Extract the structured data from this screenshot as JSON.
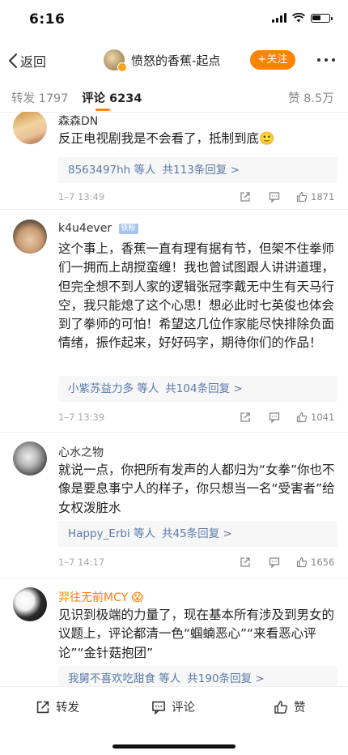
{
  "status_bar": {
    "time": "6:16",
    "battery_level": 0.5
  },
  "nav": {
    "back_label": "返回",
    "title": "愤怒的香蕉-起点",
    "follow_label": "+关注"
  },
  "tabs": [
    {
      "label": "转发 1797"
    },
    {
      "label": "评论 6234"
    },
    {
      "label": "赞 8.5万"
    }
  ],
  "comments": [
    {
      "name": "森森DN",
      "text": "反正电视剧我是不会看了，抵制到底🙂",
      "reply_users": "8563497hh 等人",
      "reply_count": "共113条回复 >",
      "time": "1–7 13:49",
      "likes": "1871"
    },
    {
      "name": "k4u4ever",
      "badge": "铁粉",
      "text": "这个事上，香蕉一直有理有据有节，但架不住拳师们一拥而上胡搅蛮缠！我也曾试图跟人讲讲道理，但完全想不到人家的逻辑张冠李戴无中生有天马行空，我只能熄了这个心思！想必此时七英俊也体会到了拳师的可怕！希望这几位作家能尽快排除负面情绪，振作起来，好好码字，期待你们的作品！",
      "reply_users": "小紫苏益力多 等人",
      "reply_count": "共104条回复 >",
      "time": "1–7 13:39",
      "likes": "1041"
    },
    {
      "name": "心水之物",
      "text": "就说一点，你把所有发声的人都归为“女拳”你也不像是要息事宁人的样子，你只想当一名“受害者”给女权泼脏水",
      "reply_users": "Happy_Erbi 等人",
      "reply_count": "共45条回复 >",
      "time": "1–7 14:17",
      "likes": "1656"
    },
    {
      "name": "羿往无前MCY",
      "emoji": "😱",
      "text": "见识到极端的力量了，现在基本所有涉及到男女的议题上，评论都清一色“蝈蝻恶心”“来看恶心评论”“金针菇抱团”",
      "reply_users": "我舅不喜欢吃甜食 等人",
      "reply_count": "共190条回复 >"
    }
  ],
  "bottom_bar": {
    "repost_label": "转发",
    "comment_label": "评论",
    "like_label": "赞"
  },
  "colors": {
    "accent": "#ff8200",
    "link": "#5a7aa9",
    "highlight_name": "#ff8200"
  }
}
